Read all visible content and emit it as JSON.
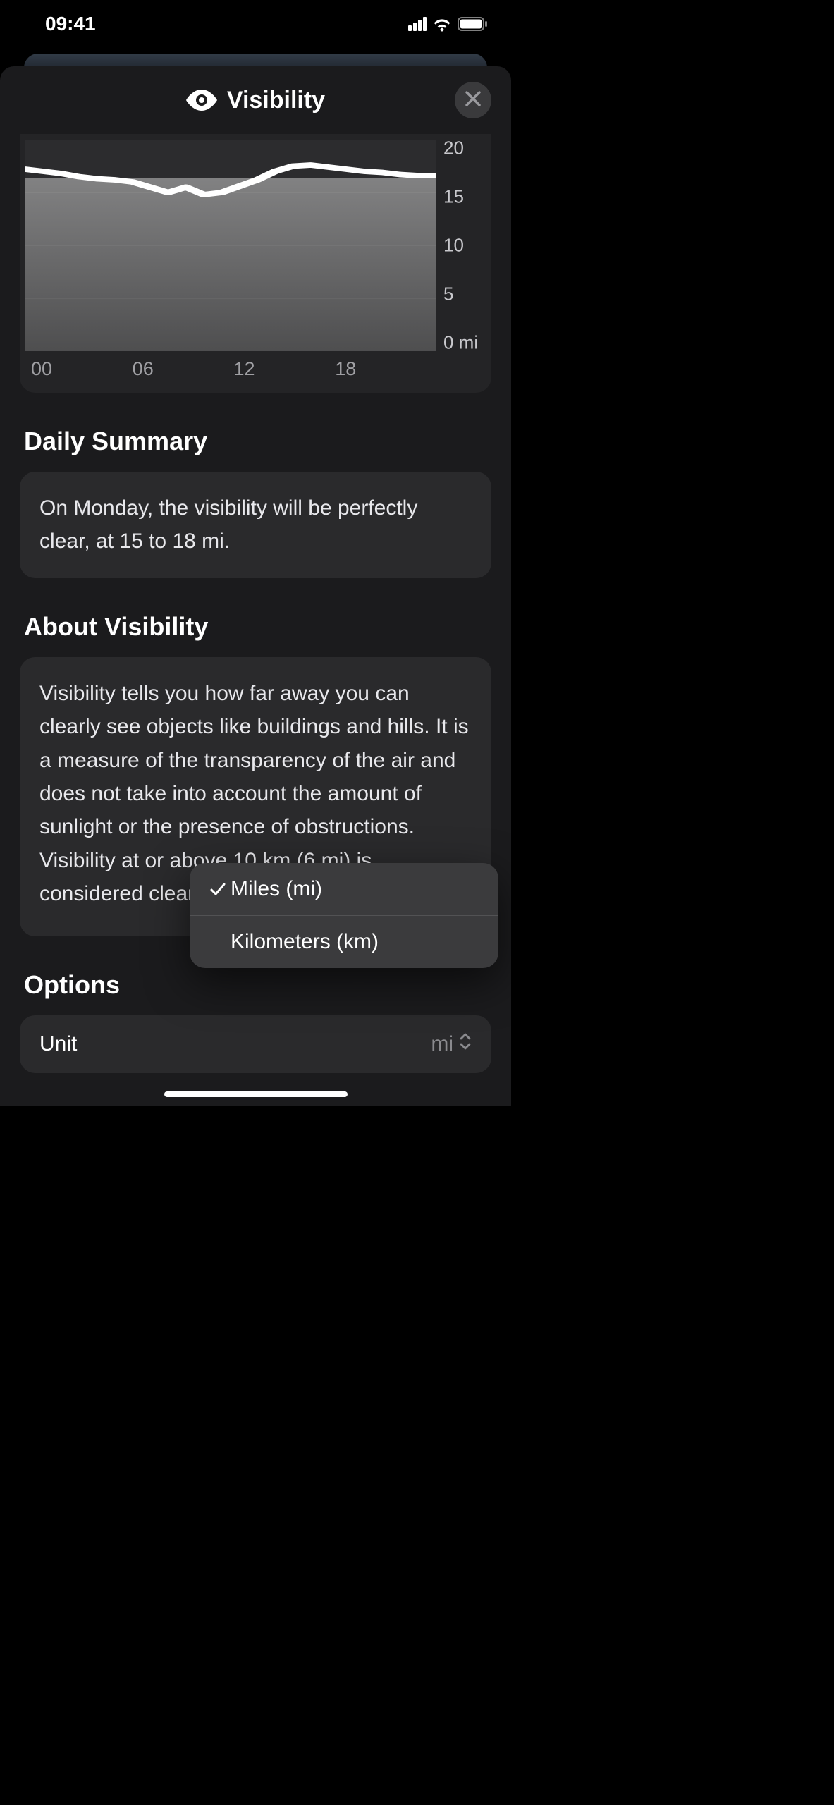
{
  "status": {
    "time": "09:41"
  },
  "header": {
    "title": "Visibility"
  },
  "chart_data": {
    "type": "line",
    "title": "",
    "xlabel": "",
    "ylabel": "",
    "x_ticks": [
      "00",
      "06",
      "12",
      "18"
    ],
    "y_ticks": [
      "20",
      "15",
      "10",
      "5",
      "0 mi"
    ],
    "ylim": [
      0,
      20
    ],
    "x": [
      0,
      1,
      2,
      3,
      4,
      5,
      6,
      7,
      8,
      9,
      10,
      11,
      12,
      13,
      14,
      15,
      16,
      17,
      18,
      19,
      20,
      21,
      22,
      23
    ],
    "values": [
      17.2,
      17.0,
      16.8,
      16.5,
      16.3,
      16.2,
      16.0,
      15.5,
      15.0,
      15.5,
      14.8,
      15.0,
      15.6,
      16.2,
      17.0,
      17.5,
      17.6,
      17.4,
      17.2,
      17.0,
      16.9,
      16.7,
      16.6,
      16.6
    ]
  },
  "daily_summary": {
    "heading": "Daily Summary",
    "text": "On Monday, the visibility will be perfectly clear, at 15 to 18 mi."
  },
  "about": {
    "heading": "About Visibility",
    "text": "Visibility tells you how far away you can clearly see objects like buildings and hills. It is a measure of the transparency of the air and does not take into account the amount of sunlight or the presence of obstructions. Visibility at or above 10 km (6 mi) is considered clear"
  },
  "options": {
    "heading": "Options",
    "unit_label": "Unit",
    "unit_value": "mi",
    "menu": [
      {
        "label": "Miles (mi)",
        "checked": true
      },
      {
        "label": "Kilometers (km)",
        "checked": false
      }
    ]
  }
}
